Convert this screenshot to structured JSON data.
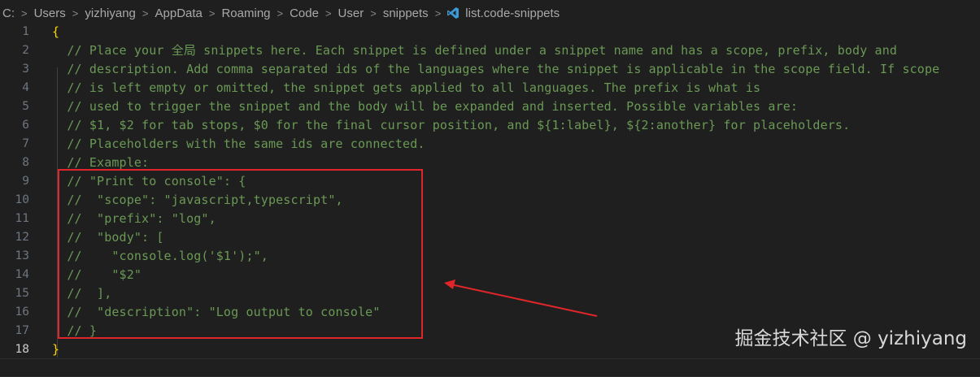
{
  "breadcrumb": {
    "segments": [
      "C:",
      "Users",
      "yizhiyang",
      "AppData",
      "Roaming",
      "Code",
      "User",
      "snippets"
    ],
    "file": "list.code-snippets",
    "separator": ">"
  },
  "editor": {
    "lines": [
      {
        "num": "1",
        "text": "{"
      },
      {
        "num": "2",
        "text": "  // Place your 全局 snippets here. Each snippet is defined under a snippet name and has a scope, prefix, body and"
      },
      {
        "num": "3",
        "text": "  // description. Add comma separated ids of the languages where the snippet is applicable in the scope field. If scope"
      },
      {
        "num": "4",
        "text": "  // is left empty or omitted, the snippet gets applied to all languages. The prefix is what is"
      },
      {
        "num": "5",
        "text": "  // used to trigger the snippet and the body will be expanded and inserted. Possible variables are:"
      },
      {
        "num": "6",
        "text": "  // $1, $2 for tab stops, $0 for the final cursor position, and ${1:label}, ${2:another} for placeholders."
      },
      {
        "num": "7",
        "text": "  // Placeholders with the same ids are connected."
      },
      {
        "num": "8",
        "text": "  // Example:"
      },
      {
        "num": "9",
        "text": "  // \"Print to console\": {"
      },
      {
        "num": "10",
        "text": "  //  \"scope\": \"javascript,typescript\","
      },
      {
        "num": "11",
        "text": "  //  \"prefix\": \"log\","
      },
      {
        "num": "12",
        "text": "  //  \"body\": ["
      },
      {
        "num": "13",
        "text": "  //    \"console.log('$1');\","
      },
      {
        "num": "14",
        "text": "  //    \"$2\""
      },
      {
        "num": "15",
        "text": "  //  ],"
      },
      {
        "num": "16",
        "text": "  //  \"description\": \"Log output to console\""
      },
      {
        "num": "17",
        "text": "  // }"
      },
      {
        "num": "18",
        "text": "}"
      }
    ],
    "active_line": "18"
  },
  "watermark": "掘金技术社区 @ yizhiyang",
  "colors": {
    "background": "#1f1f1f",
    "comment": "#6a9955",
    "brace": "#ffd700",
    "annotation": "#e0262a",
    "vscode_icon": "#3c99d4"
  }
}
